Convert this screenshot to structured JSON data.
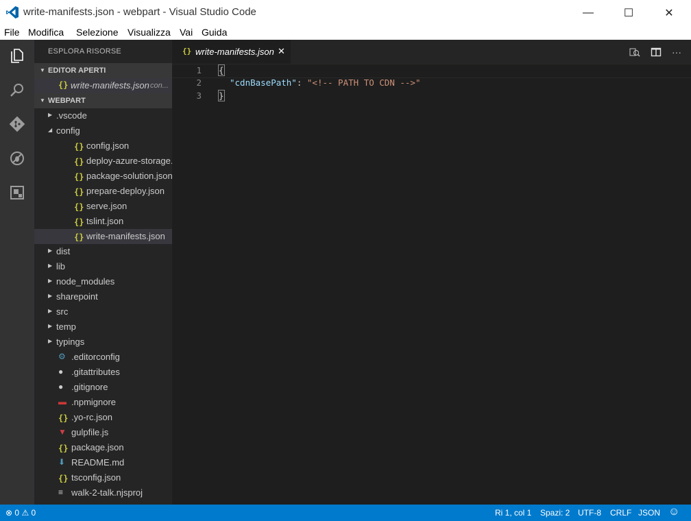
{
  "window": {
    "title": "write-manifests.json - webpart - Visual Studio Code",
    "minimize_glyph": "—",
    "maximize_glyph": "☐",
    "close_glyph": "✕"
  },
  "menu": [
    "File",
    "Modifica",
    "Selezione",
    "Visualizza",
    "Vai",
    "Guida"
  ],
  "activity_icons": [
    "explorer-icon",
    "search-icon",
    "git-icon",
    "debug-icon",
    "extensions-icon"
  ],
  "sidebar": {
    "title": "ESPLORA RISORSE",
    "open_editors": {
      "label": "EDITOR APERTI",
      "items": [
        {
          "name": "write-manifests.json",
          "desc": "con..."
        }
      ]
    },
    "project": {
      "label": "WEBPART",
      "tree": [
        {
          "name": ".vscode",
          "type": "folder",
          "expanded": false,
          "depth": 0
        },
        {
          "name": "config",
          "type": "folder",
          "expanded": true,
          "depth": 0
        },
        {
          "name": "config.json",
          "type": "json",
          "depth": 1
        },
        {
          "name": "deploy-azure-storage...",
          "type": "json",
          "depth": 1
        },
        {
          "name": "package-solution.json",
          "type": "json",
          "depth": 1
        },
        {
          "name": "prepare-deploy.json",
          "type": "json",
          "depth": 1
        },
        {
          "name": "serve.json",
          "type": "json",
          "depth": 1
        },
        {
          "name": "tslint.json",
          "type": "json",
          "depth": 1
        },
        {
          "name": "write-manifests.json",
          "type": "json",
          "depth": 1,
          "selected": true
        },
        {
          "name": "dist",
          "type": "folder",
          "expanded": false,
          "depth": 0
        },
        {
          "name": "lib",
          "type": "folder",
          "expanded": false,
          "depth": 0
        },
        {
          "name": "node_modules",
          "type": "folder",
          "expanded": false,
          "depth": 0
        },
        {
          "name": "sharepoint",
          "type": "folder",
          "expanded": false,
          "depth": 0
        },
        {
          "name": "src",
          "type": "folder",
          "expanded": false,
          "depth": 0
        },
        {
          "name": "temp",
          "type": "folder",
          "expanded": false,
          "depth": 0
        },
        {
          "name": "typings",
          "type": "folder",
          "expanded": false,
          "depth": 0
        },
        {
          "name": ".editorconfig",
          "type": "editorconfig",
          "depth": 0
        },
        {
          "name": ".gitattributes",
          "type": "git",
          "depth": 0
        },
        {
          "name": ".gitignore",
          "type": "git",
          "depth": 0
        },
        {
          "name": ".npmignore",
          "type": "npm",
          "depth": 0
        },
        {
          "name": ".yo-rc.json",
          "type": "json",
          "depth": 0
        },
        {
          "name": "gulpfile.js",
          "type": "gulp",
          "depth": 0
        },
        {
          "name": "package.json",
          "type": "json",
          "depth": 0
        },
        {
          "name": "README.md",
          "type": "markdown",
          "depth": 0
        },
        {
          "name": "tsconfig.json",
          "type": "json",
          "depth": 0
        },
        {
          "name": "walk-2-talk.njsproj",
          "type": "text",
          "depth": 0
        }
      ]
    }
  },
  "editor": {
    "tab": {
      "label": "write-manifests.json",
      "close_glyph": "✕"
    },
    "lines": [
      {
        "num": "1",
        "content": "{"
      },
      {
        "num": "2",
        "key": "\"cdnBasePath\"",
        "sep": ": ",
        "value": "\"<!-- PATH TO CDN -->\""
      },
      {
        "num": "3",
        "content": "}"
      }
    ]
  },
  "statusbar": {
    "errors": "0",
    "warnings": "0",
    "position": "Ri 1, col 1",
    "indent": "Spazi: 2",
    "encoding": "UTF-8",
    "eol": "CRLF",
    "language": "JSON",
    "smiley_glyph": "☺"
  },
  "colors": {
    "activity_bar": "#333333",
    "sidebar": "#252526",
    "editor": "#1e1e1e",
    "status_bar": "#007acc",
    "json_icon": "#cbcb41",
    "vscode_logo": "#0065a9"
  }
}
